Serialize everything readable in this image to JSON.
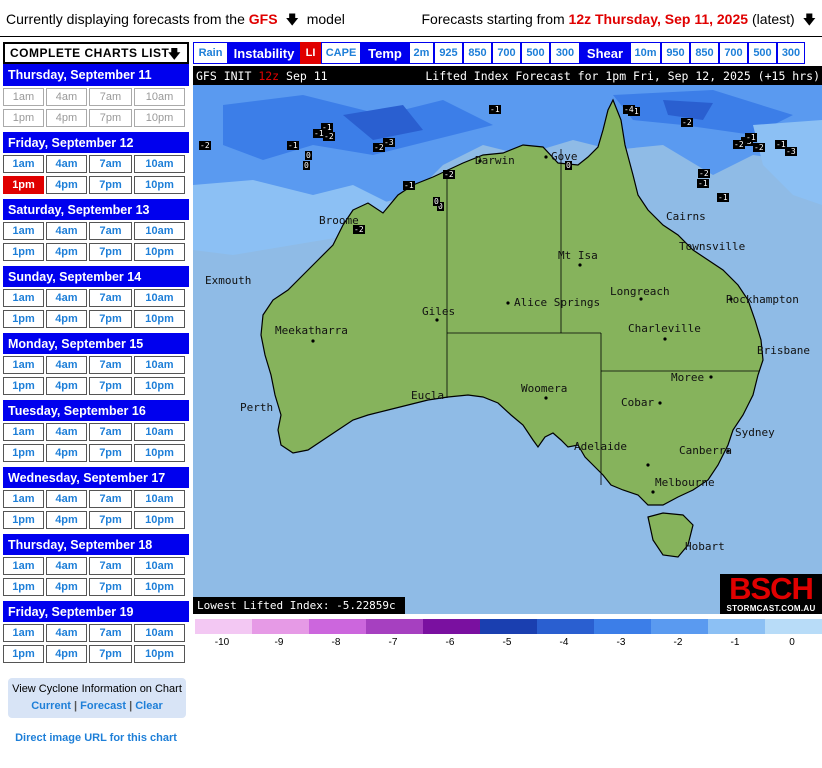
{
  "header": {
    "left_prefix": "Currently displaying forecasts from the",
    "model": "GFS",
    "model_arrow": "🡇",
    "left_suffix": "model",
    "right_prefix": "Forecasts starting from",
    "run": "12z Thursday, Sep 11, 2025",
    "right_suffix": "(latest)",
    "right_arrow": "🡇"
  },
  "sidebar": {
    "list_label": "COMPLETE CHARTS LIST",
    "list_arrow": "🡇",
    "days": [
      {
        "label": "Thursday, September 11",
        "times": [
          "1am",
          "4am",
          "7am",
          "10am",
          "1pm",
          "4pm",
          "7pm",
          "10pm"
        ]
      },
      {
        "label": "Friday, September 12",
        "times": [
          "1am",
          "4am",
          "7am",
          "10am",
          "1pm",
          "4pm",
          "7pm",
          "10pm"
        ]
      },
      {
        "label": "Saturday, September 13",
        "times": [
          "1am",
          "4am",
          "7am",
          "10am",
          "1pm",
          "4pm",
          "7pm",
          "10pm"
        ]
      },
      {
        "label": "Sunday, September 14",
        "times": [
          "1am",
          "4am",
          "7am",
          "10am",
          "1pm",
          "4pm",
          "7pm",
          "10pm"
        ]
      },
      {
        "label": "Monday, September 15",
        "times": [
          "1am",
          "4am",
          "7am",
          "10am",
          "1pm",
          "4pm",
          "7pm",
          "10pm"
        ]
      },
      {
        "label": "Tuesday, September 16",
        "times": [
          "1am",
          "4am",
          "7am",
          "10am",
          "1pm",
          "4pm",
          "7pm",
          "10pm"
        ]
      },
      {
        "label": "Wednesday, September 17",
        "times": [
          "1am",
          "4am",
          "7am",
          "10am",
          "1pm",
          "4pm",
          "7pm",
          "10pm"
        ]
      },
      {
        "label": "Thursday, September 18",
        "times": [
          "1am",
          "4am",
          "7am",
          "10am",
          "1pm",
          "4pm",
          "7pm",
          "10pm"
        ]
      },
      {
        "label": "Friday, September 19",
        "times": [
          "1am",
          "4am",
          "7am",
          "10am",
          "1pm",
          "4pm",
          "7pm",
          "10pm"
        ]
      }
    ],
    "selected": "Friday, September 12 1pm",
    "cyclone_title": "View Cyclone Information on Chart",
    "cyclone_current": "Current",
    "cyclone_forecast": "Forecast",
    "cyclone_clear": "Clear",
    "cyclone_sep": "|",
    "direct_link": "Direct image URL for this chart"
  },
  "tabs": [
    {
      "label": "Rain",
      "kind": "opt"
    },
    {
      "label": "Instability",
      "kind": "cat"
    },
    {
      "label": "LI",
      "kind": "sel"
    },
    {
      "label": "CAPE",
      "kind": "opt"
    },
    {
      "label": "Temp",
      "kind": "cat"
    },
    {
      "label": "2m",
      "kind": "opt"
    },
    {
      "label": "925",
      "kind": "opt"
    },
    {
      "label": "850",
      "kind": "opt"
    },
    {
      "label": "700",
      "kind": "opt"
    },
    {
      "label": "500",
      "kind": "opt"
    },
    {
      "label": "300",
      "kind": "opt"
    },
    {
      "label": "Shear",
      "kind": "cat"
    },
    {
      "label": "10m",
      "kind": "opt"
    },
    {
      "label": "950",
      "kind": "opt"
    },
    {
      "label": "850",
      "kind": "opt"
    },
    {
      "label": "700",
      "kind": "opt"
    },
    {
      "label": "500",
      "kind": "opt"
    },
    {
      "label": "300",
      "kind": "opt"
    }
  ],
  "map": {
    "title_left_a": "GFS INIT",
    "title_left_run": "12z",
    "title_left_b": "Sep 11",
    "title_right": "Lifted Index Forecast for 1pm Fri, Sep 12, 2025 (+15 hrs)",
    "lowest": "Lowest Lifted Index: -5.22859c",
    "logo_big": "BSCH",
    "logo_small": "STORMCAST.COM.AU",
    "cities": [
      "Darwin",
      "Gove",
      "Cairns",
      "Townsville",
      "Broome",
      "Mt Isa",
      "Exmouth",
      "Alice Springs",
      "Longreach",
      "Rockhampton",
      "Giles",
      "Meekatharra",
      "Charleville",
      "Brisbane",
      "Moree",
      "Woomera",
      "Cobar",
      "Eucla",
      "Perth",
      "Sydney",
      "Adelaide",
      "Canberra",
      "Melbourne",
      "Hobart"
    ],
    "li_labels": [
      "-2",
      "-1",
      "-1",
      "0",
      "-2",
      "-1",
      "-2",
      "-3",
      "0",
      "-2",
      "-1",
      "-3",
      "-2",
      "-1",
      "0",
      "-1",
      "-2",
      "0",
      "-1",
      "-2",
      "-1",
      "0",
      "-4",
      "-2",
      "-1",
      "-3",
      "-1",
      "-2"
    ],
    "land_color": "#86b35c"
  },
  "legend": {
    "labels": [
      "-10",
      "-9",
      "-8",
      "-7",
      "-6",
      "-5",
      "-4",
      "-3",
      "-2",
      "-1",
      "0"
    ],
    "colors": [
      "#f3c8f3",
      "#e69ae6",
      "#cc66dd",
      "#a640c0",
      "#7a10a0",
      "#1a3fb0",
      "#2a5fd0",
      "#3c7ee8",
      "#5a9af0",
      "#8cc0f4",
      "#b8dcf8"
    ]
  }
}
